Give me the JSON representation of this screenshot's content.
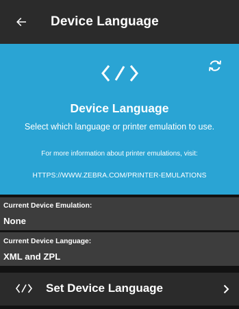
{
  "appbar": {
    "title": "Device Language",
    "back_icon": "arrow-left-icon"
  },
  "hero": {
    "icon": "code-icon",
    "refresh_icon": "refresh-icon",
    "title": "Device Language",
    "subtitle": "Select which language or printer emulation to use.",
    "info": "For more information about printer emulations, visit:",
    "link": "HTTPS://WWW.ZEBRA.COM/PRINTER-EMULATIONS",
    "background_color": "#2aa4d4"
  },
  "current_emulation": {
    "label": "Current Device Emulation:",
    "value": "None"
  },
  "current_language": {
    "label": "Current Device Language:",
    "value": "XML and ZPL"
  },
  "set_language": {
    "icon": "code-icon",
    "label": "Set Device Language",
    "chevron_icon": "chevron-right-icon"
  }
}
